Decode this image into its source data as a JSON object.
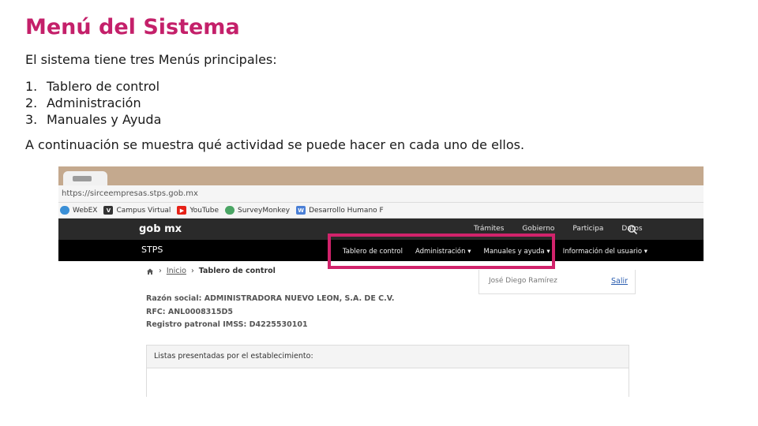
{
  "slide": {
    "title": "Menú del Sistema",
    "intro": "El sistema tiene tres Menús principales:",
    "menus": [
      {
        "num": "1.",
        "label": "Tablero de control"
      },
      {
        "num": "2.",
        "label": "Administración"
      },
      {
        "num": "3.",
        "label": "Manuales  y Ayuda"
      }
    ],
    "outro": "A continuación se muestra qué actividad se puede hacer en cada uno de ellos."
  },
  "browser": {
    "url": "https://sirceempresas.stps.gob.mx",
    "bookmarks": [
      {
        "label": "WebEX",
        "icon": "webex-icon",
        "color": "#3a8fd6"
      },
      {
        "label": "Campus Virtual",
        "icon": "campus-icon",
        "color": "#333333"
      },
      {
        "label": "YouTube",
        "icon": "youtube-icon",
        "color": "#e62117"
      },
      {
        "label": "SurveyMonkey",
        "icon": "surveymonkey-icon",
        "color": "#4aa564"
      },
      {
        "label": "Desarrollo Humano F",
        "icon": "desarrollo-icon",
        "color": "#4a7fd6"
      }
    ]
  },
  "site": {
    "logo": "gob mx",
    "top_nav": [
      "Trámites",
      "Gobierno",
      "Participa",
      "Datos"
    ],
    "section": "STPS",
    "main_nav": [
      "Tablero de control",
      "Administración ▾",
      "Manuales y ayuda ▾",
      "Información del usuario ▾"
    ],
    "breadcrumb": {
      "link": "Inicio",
      "current": "Tablero de control"
    },
    "user_name": "José Diego Ramírez",
    "logout": "Salir",
    "razon_social": "Razón social: ADMINISTRADORA NUEVO LEON, S.A. DE C.V.",
    "rfc": "RFC: ANL0008315D5",
    "registro": "Registro patronal IMSS: D4225530101",
    "panel_title": "Listas presentadas por el establecimiento:"
  },
  "colors": {
    "title": "#c4206a",
    "highlight": "#d1236b",
    "topbar": "#2a2a2a",
    "subbar": "#000000"
  }
}
